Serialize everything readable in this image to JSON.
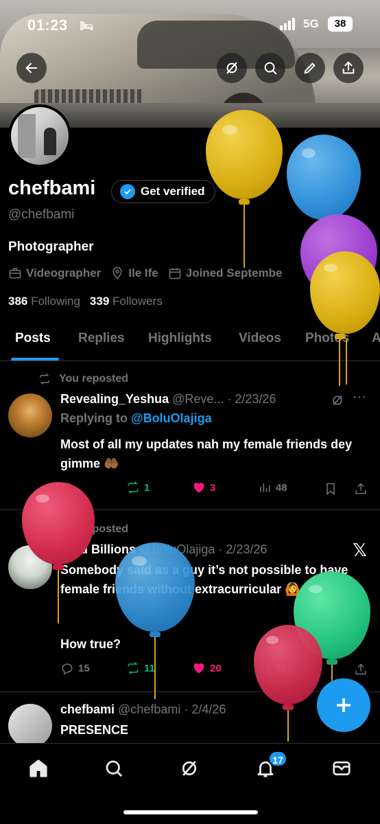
{
  "status_bar": {
    "time": "01:23",
    "network": "5G",
    "battery": "38"
  },
  "profile": {
    "name": "chefbami",
    "verify_label": "Get verified",
    "handle": "@chefbami",
    "bio": "Photographer",
    "category": "Videographer",
    "location": "Ile Ife",
    "joined": "Joined Septembe",
    "following_count": "386",
    "following_label": "Following",
    "followers_count": "339",
    "followers_label": "Followers"
  },
  "tabs": [
    "Posts",
    "Replies",
    "Highlights",
    "Videos",
    "Photos",
    "A"
  ],
  "posts": [
    {
      "repost_label": "You reposted",
      "author": "Revealing_Yeshua",
      "handle": "@Reve...",
      "date": "· 2/23/26",
      "replying_prefix": "Replying to",
      "replying_handle": "@BoluOlajiga",
      "text": "Most of all my updates nah my female friends dey gimme 🤲🏾",
      "retweets": "1",
      "likes": "3",
      "views": "48"
    },
    {
      "repost_label": "You reposted",
      "author": "Bolu Billions",
      "handle": "@BoluOlajiga",
      "date": "· 2/23/26",
      "text": "Somebody said as a guy it’s not possible to have female friends without extracurricular 🙆",
      "text2": "How true?",
      "replies": "15",
      "retweets": "11",
      "likes": "20",
      "views": "320"
    },
    {
      "author": "chefbami",
      "handle": "@chefbami",
      "date": "· 2/4/26",
      "text": "PRESENCE"
    }
  ],
  "nav": {
    "notification_count": "17"
  },
  "colors": {
    "accent": "#1d9bf0",
    "like": "#f91880",
    "repost": "#00ba7c",
    "background": "#000000"
  }
}
